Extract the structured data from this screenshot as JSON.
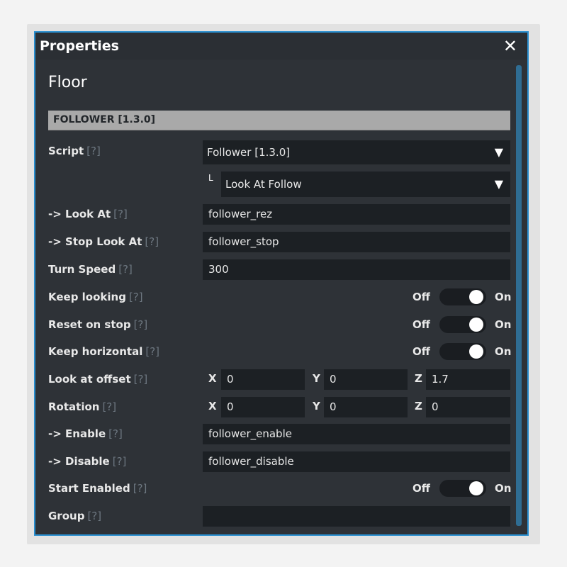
{
  "window": {
    "title": "Properties"
  },
  "heading": "Floor",
  "section": "FOLLOWER [1.3.0]",
  "help": "[?]",
  "script": {
    "label": "Script",
    "value": "Follower [1.3.0]",
    "sub_marker": "L",
    "sub_value": "Look At Follow"
  },
  "look_at": {
    "label": "-> Look At",
    "value": "follower_rez"
  },
  "stop_look_at": {
    "label": "-> Stop Look At",
    "value": "follower_stop"
  },
  "turn_speed": {
    "label": "Turn Speed",
    "value": "300"
  },
  "toggle_text": {
    "off": "Off",
    "on": "On"
  },
  "keep_looking": {
    "label": "Keep looking",
    "state": "On"
  },
  "reset_on_stop": {
    "label": "Reset on stop",
    "state": "On"
  },
  "keep_horizontal": {
    "label": "Keep horizontal",
    "state": "On"
  },
  "look_at_offset": {
    "label": "Look at offset",
    "x_label": "X",
    "x": "0",
    "y_label": "Y",
    "y": "0",
    "z_label": "Z",
    "z": "1.7"
  },
  "rotation": {
    "label": "Rotation",
    "x_label": "X",
    "x": "0",
    "y_label": "Y",
    "y": "0",
    "z_label": "Z",
    "z": "0"
  },
  "enable": {
    "label": "-> Enable",
    "value": "follower_enable"
  },
  "disable": {
    "label": "-> Disable",
    "value": "follower_disable"
  },
  "start_enabled": {
    "label": "Start Enabled",
    "state": "On"
  },
  "group": {
    "label": "Group",
    "value": ""
  },
  "colors": {
    "accent": "#2a8fd0",
    "panel": "#2e3237",
    "field": "#1c2024",
    "section": "#a9a9a9"
  }
}
